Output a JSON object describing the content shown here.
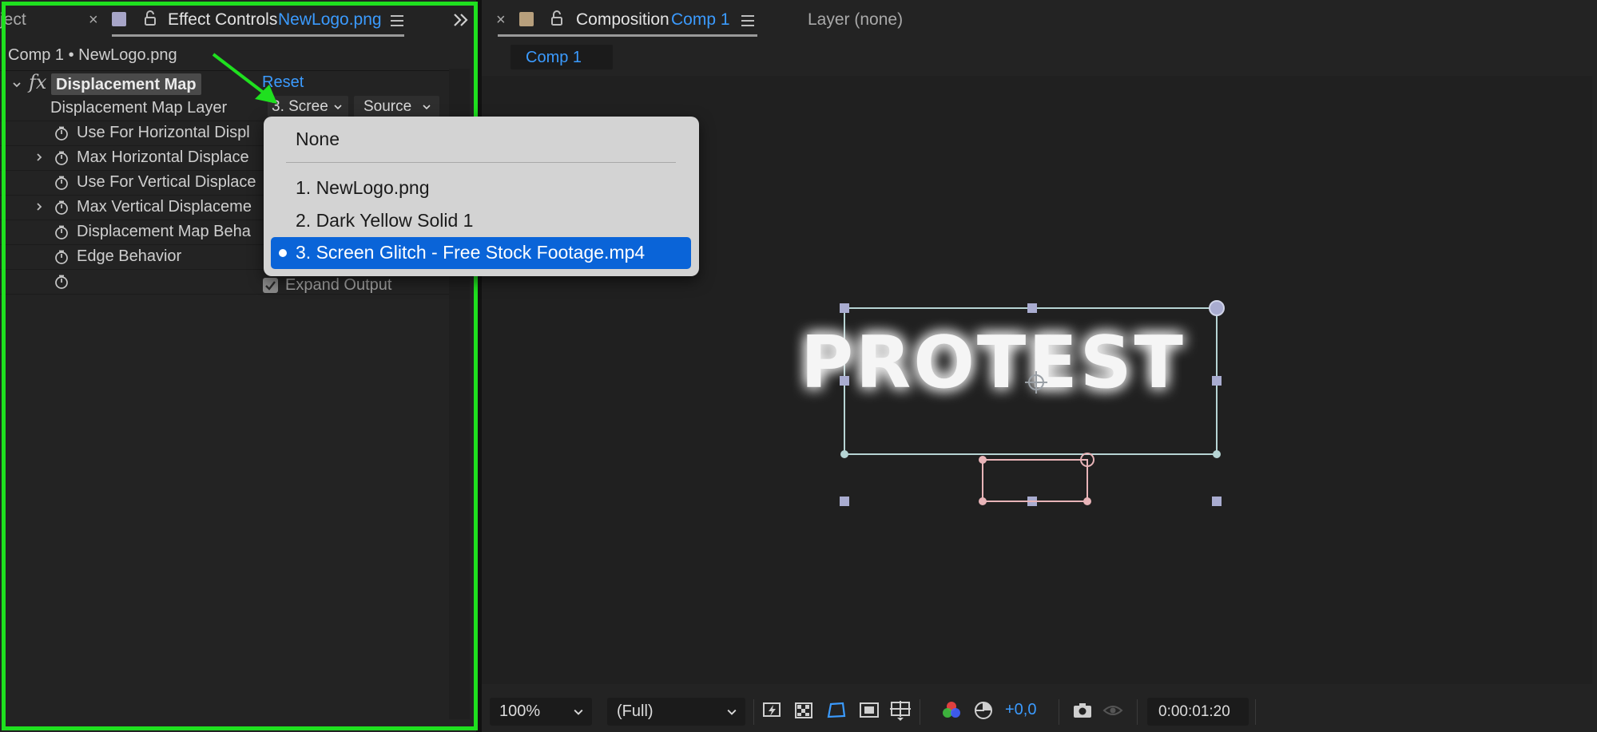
{
  "left_panel": {
    "tab_partial": "ject",
    "tab_title": "Effect Controls",
    "tab_layer": "NewLogo.png",
    "comp_line": "Comp 1 • NewLogo.png",
    "effect": {
      "name": "Displacement Map",
      "reset": "Reset",
      "rows": [
        {
          "label": "Displacement Map Layer"
        },
        {
          "label": "Use For Horizontal Displ"
        },
        {
          "label": "Max Horizontal Displace"
        },
        {
          "label": "Use For Vertical Displace"
        },
        {
          "label": "Max Vertical Displaceme"
        },
        {
          "label": "Displacement Map Beha"
        },
        {
          "label": "Edge Behavior"
        }
      ],
      "layer_dropdown": "3. Scree",
      "source_dropdown": "Source",
      "expand_output": "Expand Output"
    }
  },
  "popup": {
    "items": [
      "None",
      "1. NewLogo.png",
      "2. Dark Yellow Solid 1"
    ],
    "selected": "3. Screen Glitch - Free Stock Footage.mp4"
  },
  "right_panel": {
    "tab_title": "Composition",
    "tab_comp": "Comp 1",
    "layer_tab": "Layer (none)",
    "comp_subtab": "Comp 1",
    "logo_text": "PROTEST",
    "bottom": {
      "zoom": "100%",
      "resolution": "(Full)",
      "exposure": "+0,0",
      "timecode": "0:00:01:20"
    }
  },
  "colors": {
    "highlight": "#1fe01f",
    "accent_blue": "#3b9bff",
    "menu_selected": "#0a64d8",
    "panel_bg": "#232323"
  },
  "icons": [
    "close-icon",
    "lock-icon",
    "panel-menu-icon",
    "stopwatch-icon",
    "twirl-icon",
    "chevron-down-icon",
    "checkbox-icon",
    "camera-icon",
    "color-channels-icon"
  ]
}
